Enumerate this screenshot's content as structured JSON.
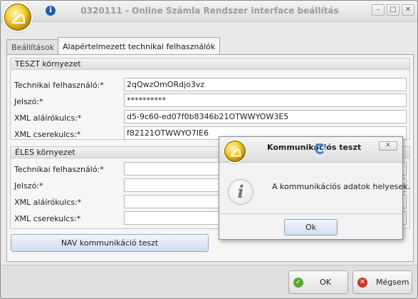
{
  "window": {
    "title": "0320111 - Online Számla Rendszer interface beállítás",
    "buttons": {
      "minimize": "–",
      "maximize": "□",
      "close": "✕"
    },
    "info_glyph": "i"
  },
  "tabs": [
    {
      "label": "Beállítások",
      "active": false
    },
    {
      "label": "Alapértelmezett technikai felhasználók",
      "active": true
    }
  ],
  "test_env": {
    "heading": "TESZT környezet",
    "fields": [
      {
        "label": "Technikai felhasználó:*",
        "value": "2qQwzOmORdjo3vz"
      },
      {
        "label": "Jelszó:*",
        "value": "**********"
      },
      {
        "label": "XML aláírókulcs:*",
        "value": "d5-9c60-ed07f0b8346b21OTWWYOW3E5"
      },
      {
        "label": "XML cserekulcs:*",
        "value": "f82121OTWWYO7IE6"
      }
    ]
  },
  "live_env": {
    "heading": "ÉLES környezet",
    "fields": [
      {
        "label": "Technikai felhasználó:*",
        "value": ""
      },
      {
        "label": "Jelszó:*",
        "value": ""
      },
      {
        "label": "XML aláírókulcs:*",
        "value": ""
      },
      {
        "label": "XML cserekulcs:*",
        "value": ""
      }
    ]
  },
  "nav_test_button": "NAV kommunikáció teszt",
  "footer": {
    "ok": "OK",
    "cancel": "Mégsem"
  },
  "dialog": {
    "title": "Kommunikációs teszt",
    "message": "A kommunikációs adatok helyesek.",
    "ok": "Ok",
    "close_glyph": "✕",
    "info_glyph": "i"
  },
  "icons": {
    "app_logo": "app-logo-icon",
    "ok": "check-icon",
    "cancel": "close-icon",
    "busy": "spinner-icon"
  },
  "colors": {
    "accent_blue": "#3a86d6",
    "ok_green": "#58a82a",
    "cancel_red": "#c8362a",
    "logo_gold": "#f4cf2f"
  }
}
